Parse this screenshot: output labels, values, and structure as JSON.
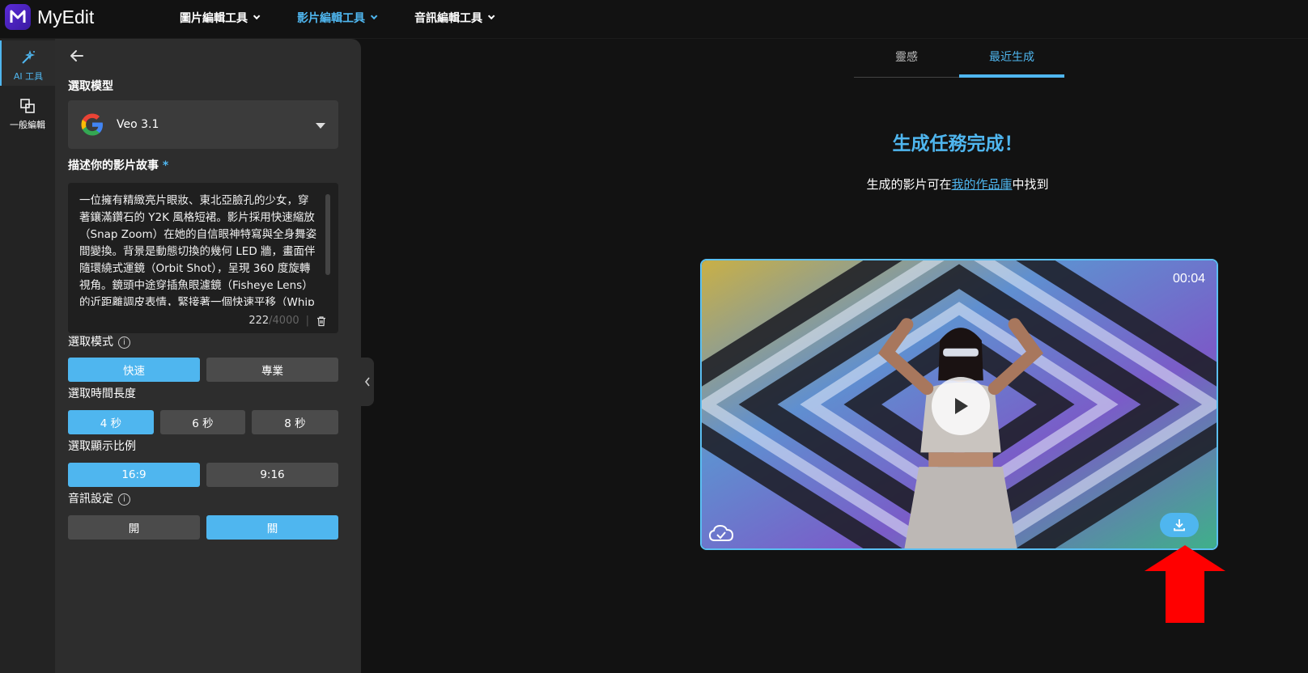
{
  "app": {
    "name": "MyEdit"
  },
  "nav": [
    {
      "label": "圖片編輯工具",
      "active": false
    },
    {
      "label": "影片編輯工具",
      "active": true
    },
    {
      "label": "音訊編輯工具",
      "active": false
    }
  ],
  "rail": [
    {
      "label": "AI 工具",
      "icon": "magic-wand-icon",
      "active": true
    },
    {
      "label": "一般編輯",
      "icon": "layers-icon",
      "active": false
    }
  ],
  "panel": {
    "model_label": "選取模型",
    "model_value": "Veo 3.1",
    "prompt_label": "描述你的影片故事",
    "prompt_required": "*",
    "prompt_text": "一位擁有精緻亮片眼妝、東北亞臉孔的少女，穿著鑲滿鑽石的 Y2K 風格短裙。影片採用快速縮放（Snap Zoom）在她的自信眼神特寫與全身舞姿間變換。背景是動態切換的幾何 LED 牆，畫面伴隨環繞式運鏡（Orbit Shot），呈現 360 度旋轉視角。鏡頭中途穿插魚眼濾鏡（Fisheye Lens）的近距離調皮表情，緊接著一個快速平移（Whip",
    "char_count": "222",
    "char_max": "/4000",
    "char_sep": "|",
    "mode_label": "選取模式",
    "mode_options": [
      "快速",
      "專業"
    ],
    "mode_selected": "快速",
    "duration_label": "選取時間長度",
    "duration_options": [
      "4 秒",
      "6 秒",
      "8 秒"
    ],
    "duration_selected": "4 秒",
    "ratio_label": "選取顯示比例",
    "ratio_options": [
      "16:9",
      "9:16"
    ],
    "ratio_selected": "16:9",
    "audio_label": "音訊設定",
    "audio_options": [
      "開",
      "關"
    ],
    "audio_selected": "關"
  },
  "main": {
    "tabs": [
      {
        "label": "靈感",
        "active": false
      },
      {
        "label": "最近生成",
        "active": true
      }
    ],
    "done_title": "生成任務完成！",
    "done_sub_before": "生成的影片可在",
    "done_sub_link": "我的作品庫",
    "done_sub_after": "中找到",
    "video": {
      "duration": "00:04"
    }
  },
  "colors": {
    "accent": "#4fb6ef",
    "panel": "#2d2d2d",
    "bg": "#121212",
    "arrow": "#ff0000"
  }
}
